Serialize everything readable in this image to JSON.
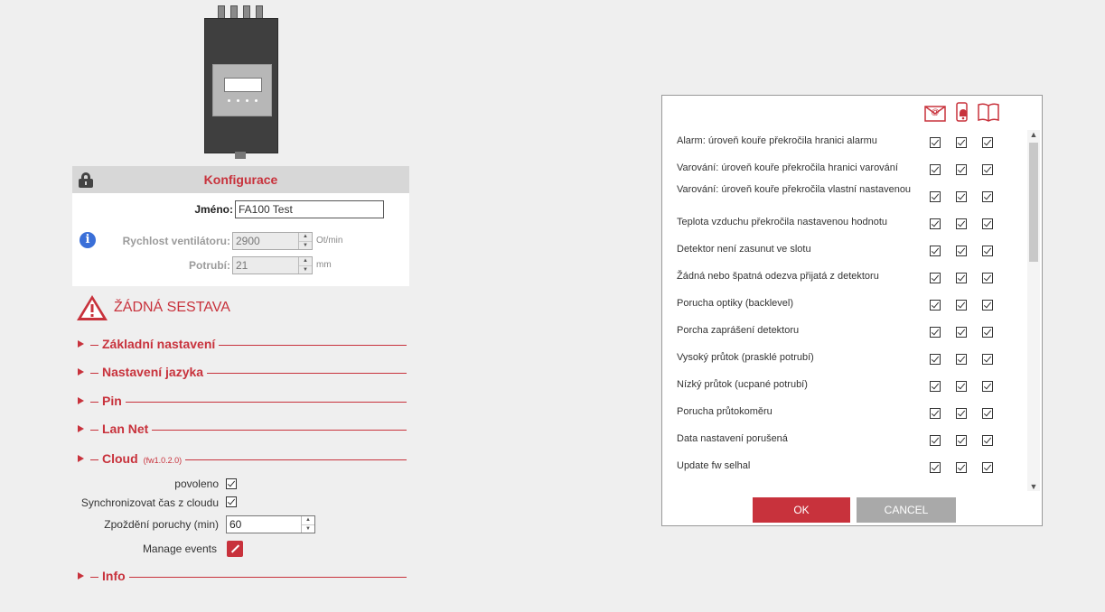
{
  "config": {
    "title": "Konfigurace",
    "name_label": "Jméno:",
    "name_value": "FA100 Test",
    "fan_speed_label": "Rychlost ventilátoru:",
    "fan_speed_value": "2900",
    "fan_speed_unit": "Ot/min",
    "pipe_label": "Potrubí:",
    "pipe_value": "21",
    "pipe_unit": "mm"
  },
  "warning": {
    "text": "ŽÁDNÁ SESTAVA"
  },
  "sections": [
    {
      "label": "Základní nastavení"
    },
    {
      "label": "Nastavení jazyka"
    },
    {
      "label": "Pin"
    },
    {
      "label": "Lan Net"
    },
    {
      "label": "Cloud",
      "fw": "(fw1.0.2.0)"
    },
    {
      "label": "Info"
    }
  ],
  "cloud": {
    "enabled_label": "povoleno",
    "enabled": true,
    "sync_label": "Synchronizovat čas z cloudu",
    "sync": true,
    "delay_label": "Zpoždění poruchy (min)",
    "delay_value": "60",
    "manage_label": "Manage events"
  },
  "dialog": {
    "columns": [
      "email-icon",
      "phone-alarm-icon",
      "book-icon"
    ],
    "events": [
      {
        "text": "Alarm: úroveň kouře překročila hranici alarmu",
        "checks": [
          true,
          true,
          true
        ]
      },
      {
        "text": "Varování: úroveň kouře překročila hranici varování",
        "checks": [
          true,
          true,
          true
        ]
      },
      {
        "text": "Varování: úroveň kouře překročila vlastní nastavenou",
        "checks": [
          true,
          true,
          true
        ]
      },
      {
        "text": "Teplota vzduchu překročila nastavenou hodnotu",
        "checks": [
          true,
          true,
          true
        ]
      },
      {
        "text": "Detektor není zasunut ve slotu",
        "checks": [
          true,
          true,
          true
        ]
      },
      {
        "text": "Žádná nebo špatná odezva přijatá z detektoru",
        "checks": [
          true,
          true,
          true
        ]
      },
      {
        "text": "Porucha optiky (backlevel)",
        "checks": [
          true,
          true,
          true
        ]
      },
      {
        "text": "Porcha zaprášení detektoru",
        "checks": [
          true,
          true,
          true
        ]
      },
      {
        "text": "Vysoký průtok (prasklé potrubí)",
        "checks": [
          true,
          true,
          true
        ]
      },
      {
        "text": "Nízký průtok (ucpané potrubí)",
        "checks": [
          true,
          true,
          true
        ]
      },
      {
        "text": "Porucha průtokoměru",
        "checks": [
          true,
          true,
          true
        ]
      },
      {
        "text": "Data nastavení porušená",
        "checks": [
          true,
          true,
          true
        ]
      },
      {
        "text": "Update fw selhal",
        "checks": [
          true,
          true,
          true
        ]
      }
    ],
    "ok_label": "OK",
    "cancel_label": "CANCEL"
  },
  "colors": {
    "accent": "#c8323c",
    "info": "#3a6fd8",
    "cancel": "#a9a9a9"
  }
}
